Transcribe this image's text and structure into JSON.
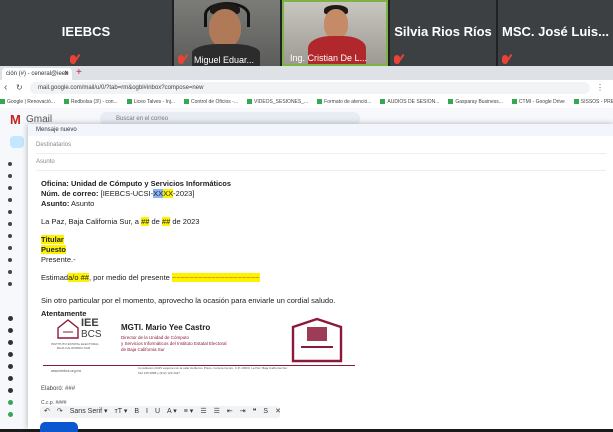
{
  "meeting": {
    "tiles": [
      {
        "name": "IEEBCS"
      },
      {
        "caption": "Miguel Eduar..."
      },
      {
        "caption": "Ing. Cristian De L..."
      },
      {
        "name": "Silvia Rios Ríos"
      },
      {
        "name": "MSC. José Luis..."
      }
    ]
  },
  "browser": {
    "tab_title": "ción (#) - ceneral@ieeb",
    "url": "mail.google.com/mail/u/0/?tab=rm&ogbl#inbox?compose=new",
    "bookmarks": [
      "Google | Renovació...",
      "Redbolsa (3!) - con...",
      "Liceo Talves - Inj...",
      "Control de Oficios -...",
      "VIDEOS_SESIONES_...",
      "Formato de atenció...",
      "AUDIOS DE SESION...",
      "Gasparay Business...",
      "CTMI - Google Drive",
      "SISSOS - PREP 2021..."
    ]
  },
  "gmail": {
    "app_name": "Gmail",
    "search_placeholder": "Buscar en el correo"
  },
  "compose": {
    "title": "Mensaje nuevo",
    "to_placeholder": "Destinatarios",
    "subject_placeholder": "Asunto",
    "office_label": "Oficina:",
    "office_value": "Unidad de Cómputo y Servicios Informáticos",
    "num_label": "Núm. de correo:",
    "num_prefix": "[IEEBCS-UCSI-",
    "num_sel": "XX",
    "num_hl": "XX",
    "num_suffix": "-2023]",
    "subject_label": "Asunto:",
    "subject_value": "Asunto",
    "date_prefix": "La Paz, Baja California Sur, a ",
    "date_day": "##",
    "date_mid": " de ",
    "date_month": "##",
    "date_suffix": " de 2023",
    "titular": "Titular",
    "puesto": "Puesto",
    "presente": "Presente.-",
    "greeting_a": "Estimad",
    "greeting_b": "a/o ##",
    "greeting_c": ", por medio del presente ",
    "greeting_d": "~~~~~~~~~~~~~~~~~~~~",
    "closing": "Sin otro particular por el momento, aprovecho la ocasión para enviarle un cordial saludo.",
    "atentamente": "Atentamente",
    "sig_name": "MGTI. Mario Yee Castro",
    "sig_role1": "Director de la Unidad de Cómputo",
    "sig_role2": "y Servicios Informáticos del Instituto Estatal Electoral",
    "sig_role3": "de Baja California Sur",
    "sig_logo_ie": "IEE",
    "sig_logo_bcs": "BCS",
    "sig_inst": "INSTITUTO ESTATAL ELECTORAL",
    "sig_inst2": "BAJA CALIFORNIA SUR",
    "sig_web": "www.ieebcs.org.mx",
    "sig_address": "Constitución #415 esquina con la calle Guillermo Prieto, Colonia Centro, C.P. 23000, La Paz, Baja California Sur.",
    "sig_phone": "612 125 0808 y (612) 129 4447",
    "elaboro": "Elaboró: ###",
    "ccp": "C.c.p. ####",
    "format_tools": [
      "↶",
      "↷",
      "Sans Serif ▾",
      "тT ▾",
      "B",
      "I",
      "U",
      "A ▾",
      "≡ ▾",
      "☰",
      "☰",
      "⇤",
      "⇥",
      "❝",
      "S",
      "✕"
    ]
  },
  "colors": {
    "highlight": "#fff200",
    "brand_wine": "#8b1a3a",
    "muted_red": "#ea4335",
    "send_blue": "#0b57d0"
  }
}
